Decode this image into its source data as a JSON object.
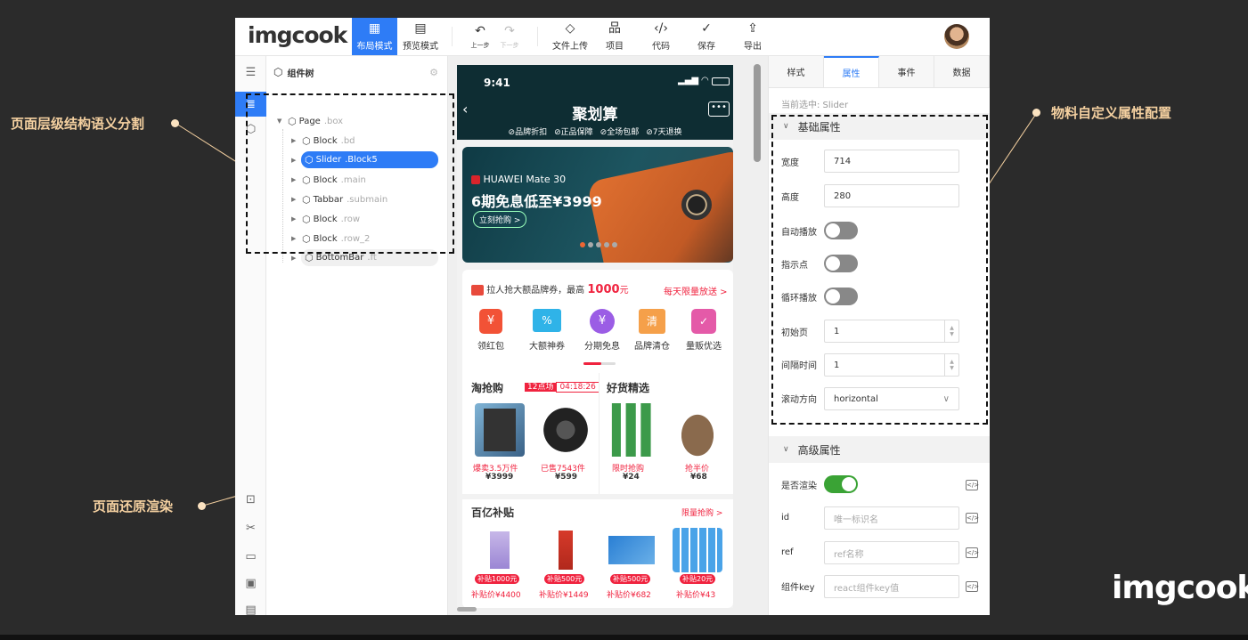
{
  "annotations": {
    "left_top": "页面层级结构语义分割",
    "left_bottom": "页面还原渲染",
    "right": "物料自定义属性配置"
  },
  "corner_logo": "imgcook",
  "toolbar": {
    "logo": "imgcook",
    "buttons": [
      {
        "label": "布局模式",
        "icon": "layout-icon"
      },
      {
        "label": "预览模式",
        "icon": "preview-icon"
      },
      {
        "label": "上一步",
        "icon": "undo-icon"
      },
      {
        "label": "下一步",
        "icon": "redo-icon"
      },
      {
        "label": "文件上传",
        "icon": "diamond-icon"
      },
      {
        "label": "项目",
        "icon": "project-icon"
      },
      {
        "label": "代码",
        "icon": "code-icon"
      },
      {
        "label": "保存",
        "icon": "check-circle-icon"
      },
      {
        "label": "导出",
        "icon": "export-icon"
      }
    ]
  },
  "tree": {
    "title": "组件树",
    "nodes": [
      {
        "name": "Page",
        "cls": ".box"
      },
      {
        "name": "Block",
        "cls": ".bd"
      },
      {
        "name": "Slider",
        "cls": ".Block5"
      },
      {
        "name": "Block",
        "cls": ".main"
      },
      {
        "name": "Tabbar",
        "cls": ".submain"
      },
      {
        "name": "Block",
        "cls": ".row"
      },
      {
        "name": "Block",
        "cls": ".row_2"
      },
      {
        "name": "BottomBar",
        "cls": ".ft"
      }
    ]
  },
  "phone": {
    "time": "9:41",
    "title": "聚划算",
    "services": [
      "品牌折扣",
      "正品保障",
      "全场包邮",
      "7天退换"
    ],
    "banner": {
      "brand": "HUAWEI Mate 30",
      "headline": "6期免息低至¥3999",
      "cta": "立刻抢购 >"
    },
    "promo": {
      "text": "拉人抢大额品牌券，最高",
      "amount": "1000",
      "unit": "元",
      "link": "每天限量放送 >"
    },
    "categories": [
      "领红包",
      "大额神券",
      "分期免息",
      "品牌清仓",
      "量贩优选"
    ],
    "section1": {
      "title": "淘抢购",
      "badge": "12点场",
      "timer": "04:18:26"
    },
    "section2": {
      "title": "好货精选"
    },
    "products1": [
      {
        "tag": "爆卖3.5万件",
        "price": "¥3999"
      },
      {
        "tag": "已售7543件",
        "price": "¥599"
      },
      {
        "tag": "限时抢购",
        "price": "¥24"
      },
      {
        "tag": "抢半价",
        "price": "¥68"
      }
    ],
    "section3": {
      "title": "百亿补贴",
      "link": "限量抢购 >"
    },
    "products2": [
      {
        "badge": "补贴1000元",
        "price": "补贴价¥4400"
      },
      {
        "badge": "补贴500元",
        "price": "补贴价¥1449"
      },
      {
        "badge": "补贴500元",
        "price": "补贴价¥682"
      },
      {
        "badge": "补贴20元",
        "price": "补贴价¥43"
      }
    ]
  },
  "panel": {
    "tabs": [
      "样式",
      "属性",
      "事件",
      "数据"
    ],
    "current": "当前选中: Slider",
    "basic_title": "基础属性",
    "fields": {
      "width_label": "宽度",
      "width": "714",
      "height_label": "高度",
      "height": "280",
      "autoplay_label": "自动播放",
      "dots_label": "指示点",
      "loop_label": "循环播放",
      "initial_label": "初始页",
      "initial": "1",
      "interval_label": "间隔时间",
      "interval": "1",
      "direction_label": "滚动方向",
      "direction": "horizontal"
    },
    "advanced_title": "高级属性",
    "adv": {
      "render_label": "是否渲染",
      "id_label": "id",
      "id_placeholder": "唯一标识名",
      "ref_label": "ref",
      "ref_placeholder": "ref名称",
      "key_label": "组件key",
      "key_placeholder": "react组件key值"
    }
  }
}
